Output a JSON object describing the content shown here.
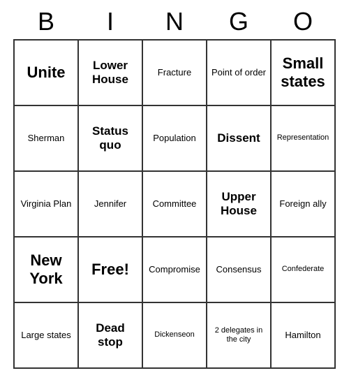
{
  "header": {
    "letters": [
      "B",
      "I",
      "N",
      "G",
      "O"
    ]
  },
  "cells": [
    {
      "text": "Unite",
      "size": "large"
    },
    {
      "text": "Lower House",
      "size": "medium"
    },
    {
      "text": "Fracture",
      "size": "normal"
    },
    {
      "text": "Point of order",
      "size": "normal"
    },
    {
      "text": "Small states",
      "size": "large"
    },
    {
      "text": "Sherman",
      "size": "normal"
    },
    {
      "text": "Status quo",
      "size": "medium"
    },
    {
      "text": "Population",
      "size": "normal"
    },
    {
      "text": "Dissent",
      "size": "medium"
    },
    {
      "text": "Representation",
      "size": "small"
    },
    {
      "text": "Virginia Plan",
      "size": "normal"
    },
    {
      "text": "Jennifer",
      "size": "normal"
    },
    {
      "text": "Committee",
      "size": "normal"
    },
    {
      "text": "Upper House",
      "size": "medium"
    },
    {
      "text": "Foreign ally",
      "size": "normal"
    },
    {
      "text": "New York",
      "size": "large"
    },
    {
      "text": "Free!",
      "size": "free"
    },
    {
      "text": "Compromise",
      "size": "normal"
    },
    {
      "text": "Consensus",
      "size": "normal"
    },
    {
      "text": "Confederate",
      "size": "small"
    },
    {
      "text": "Large states",
      "size": "normal"
    },
    {
      "text": "Dead stop",
      "size": "medium"
    },
    {
      "text": "Dickenseon",
      "size": "small"
    },
    {
      "text": "2 delegates in the city",
      "size": "small"
    },
    {
      "text": "Hamilton",
      "size": "normal"
    }
  ]
}
